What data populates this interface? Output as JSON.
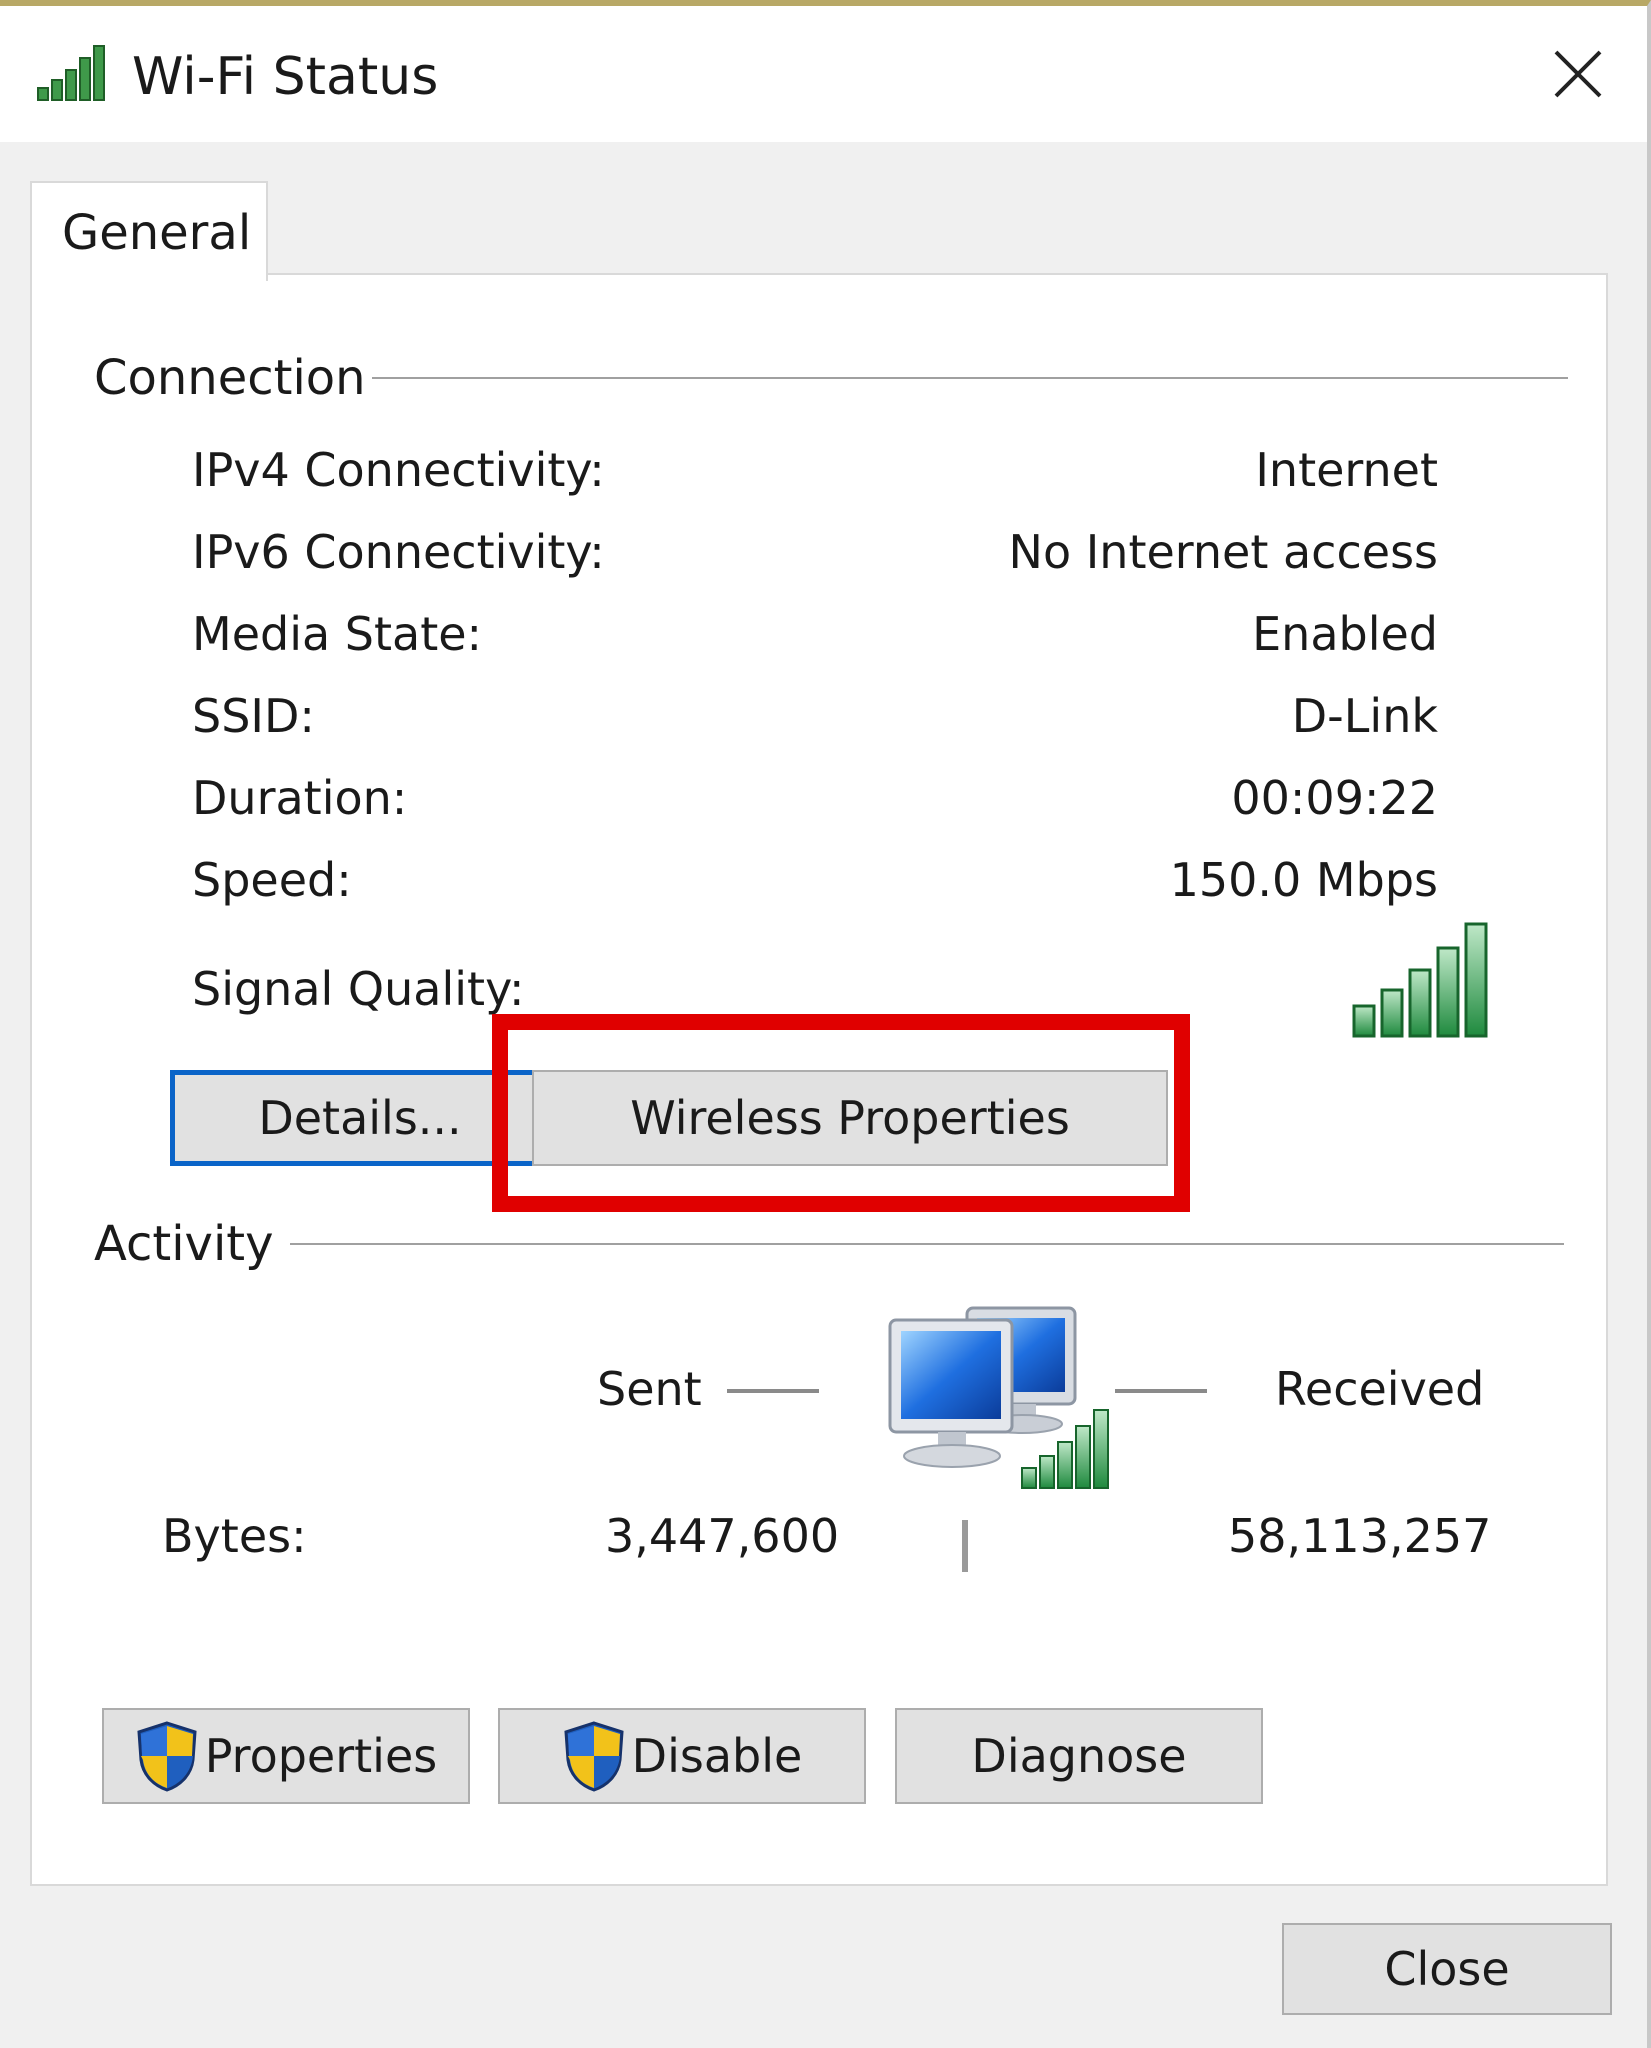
{
  "window": {
    "title": "Wi-Fi Status",
    "title_icon": "wifi-signal-icon",
    "close_icon": "close-icon"
  },
  "tabs": [
    {
      "label": "General",
      "selected": true
    }
  ],
  "connection": {
    "group_title": "Connection",
    "rows": [
      {
        "label": "IPv4 Connectivity:",
        "value": "Internet"
      },
      {
        "label": "IPv6 Connectivity:",
        "value": "No Internet access"
      },
      {
        "label": "Media State:",
        "value": "Enabled"
      },
      {
        "label": "SSID:",
        "value": "D-Link"
      },
      {
        "label": "Duration:",
        "value": "00:09:22"
      },
      {
        "label": "Speed:",
        "value": "150.0 Mbps"
      }
    ],
    "signal_quality_label": "Signal Quality:",
    "signal_bars": 5,
    "signal_bars_max": 5,
    "details_button": "Details...",
    "wireless_properties_button": "Wireless Properties"
  },
  "activity": {
    "group_title": "Activity",
    "sent_label": "Sent",
    "received_label": "Received",
    "bytes_label": "Bytes:",
    "bytes_sent": "3,447,600",
    "bytes_received": "58,113,257",
    "icon": "network-computers-icon"
  },
  "bottom_buttons": {
    "properties": "Properties",
    "disable": "Disable",
    "diagnose": "Diagnose"
  },
  "footer": {
    "close_button": "Close"
  },
  "colors": {
    "highlight": "#e00000",
    "focus": "#0a64c8",
    "signal_green": "#2e9e4e"
  }
}
